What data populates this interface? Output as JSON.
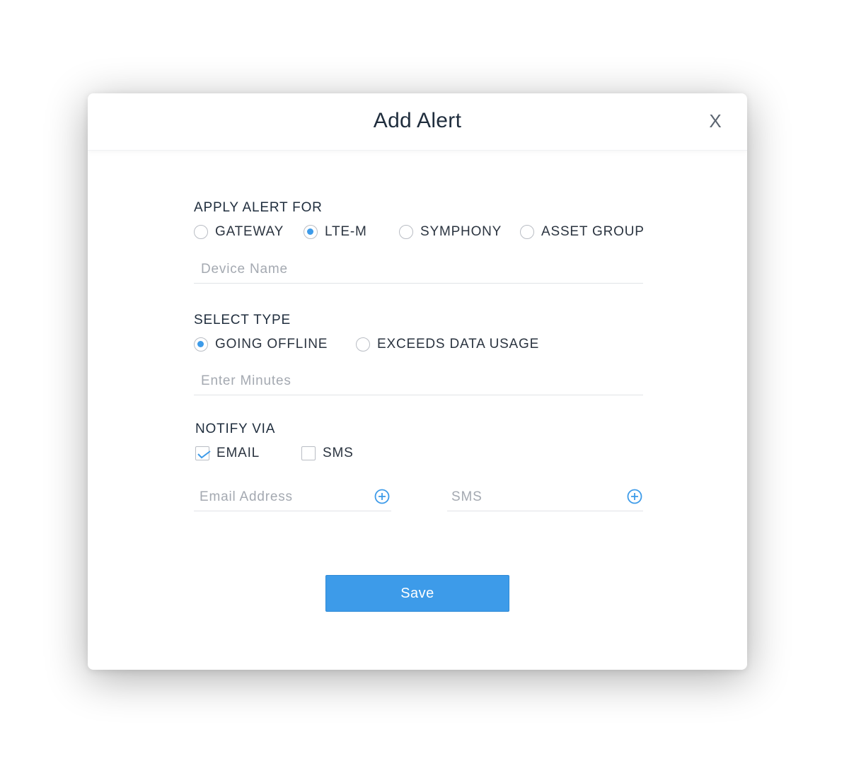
{
  "dialog": {
    "title": "Add Alert",
    "close_label": "X"
  },
  "apply_alert": {
    "label": "APPLY ALERT FOR",
    "options": [
      {
        "label": "GATEWAY",
        "selected": false
      },
      {
        "label": "LTE-M",
        "selected": true
      },
      {
        "label": "SYMPHONY",
        "selected": false
      },
      {
        "label": "ASSET GROUP",
        "selected": false
      }
    ],
    "device_name_placeholder": "Device Name",
    "device_name_value": ""
  },
  "select_type": {
    "label": "SELECT TYPE",
    "options": [
      {
        "label": "GOING OFFLINE",
        "selected": true
      },
      {
        "label": "EXCEEDS DATA USAGE",
        "selected": false
      }
    ],
    "minutes_placeholder": "Enter Minutes",
    "minutes_value": ""
  },
  "notify_via": {
    "label": "NOTIFY VIA",
    "options": [
      {
        "label": "EMAIL",
        "checked": true
      },
      {
        "label": "SMS",
        "checked": false
      }
    ],
    "email_placeholder": "Email Address",
    "sms_placeholder": "SMS"
  },
  "actions": {
    "save_label": "Save"
  },
  "icons": {
    "close": "close-icon",
    "add": "plus-circle-icon",
    "check": "checkmark-icon"
  },
  "colors": {
    "accent": "#3d9be9",
    "title_text": "#1f2d3d",
    "placeholder": "#a4a9b1",
    "border": "#e1e3e7"
  }
}
